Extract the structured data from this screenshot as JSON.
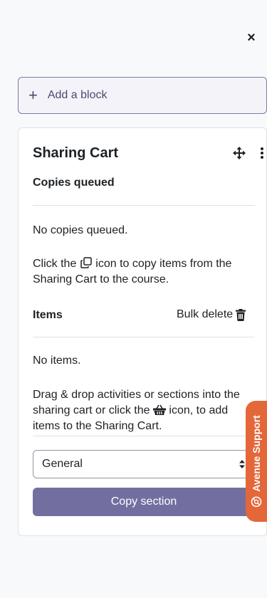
{
  "close_label": "×",
  "add_block": {
    "plus": "+",
    "label": "Add a block"
  },
  "block": {
    "title": "Sharing Cart",
    "copies": {
      "heading": "Copies queued",
      "empty": "No copies queued.",
      "help_before": "Click the",
      "help_after": "icon to copy items from the Sharing Cart to the course."
    },
    "items": {
      "heading": "Items",
      "bulk_delete": "Bulk delete",
      "empty": "No items.",
      "help_before": "Drag & drop activities or sections into the sharing cart or click the",
      "help_after": "icon, to add items to the Sharing Cart."
    },
    "section_select": {
      "selected": "General"
    },
    "copy_button": "Copy section"
  },
  "support_tab": {
    "label": "Avenue Support"
  },
  "colors": {
    "accent": "#726fa0",
    "support": "#e4673a",
    "background": "#f8f9fa"
  },
  "icons": [
    "close-icon",
    "plus-icon",
    "move-icon",
    "kebab-menu-icon",
    "copy-icon",
    "trash-icon",
    "basket-icon",
    "select-chevron-icon",
    "support-icon"
  ]
}
